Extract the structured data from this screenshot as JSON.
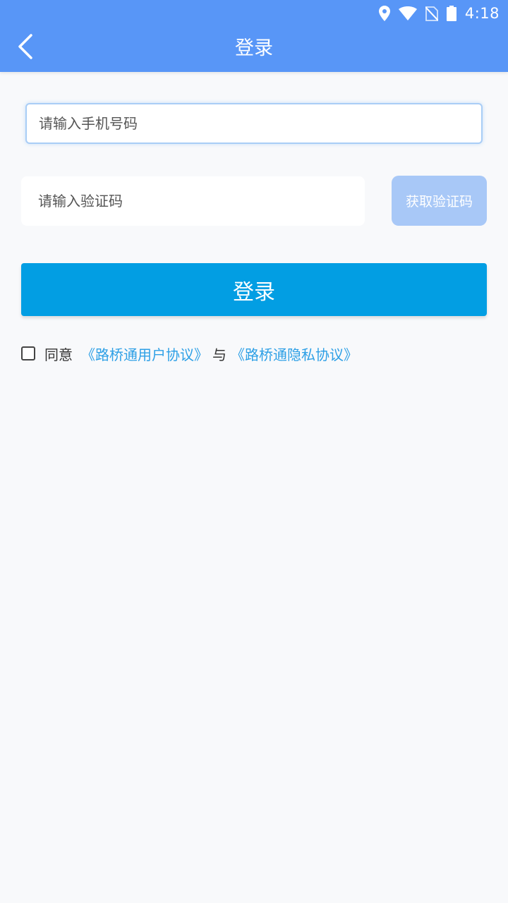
{
  "status_bar": {
    "time": "4:18",
    "icons": [
      "location-icon",
      "wifi-icon",
      "no-sim-icon",
      "battery-icon"
    ]
  },
  "header": {
    "title": "登录",
    "back_icon": "chevron-left-icon"
  },
  "form": {
    "phone_placeholder": "请输入手机号码",
    "code_placeholder": "请输入验证码",
    "get_code_label": "获取验证码",
    "login_label": "登录"
  },
  "agreement": {
    "agree_label": "同意",
    "user_agreement": "《路桥通用户协议》",
    "joiner": "与",
    "privacy_agreement": "《路桥通隐私协议》",
    "checked": false
  },
  "colors": {
    "header_bg": "#5896f7",
    "login_button": "#029ee3",
    "get_code_button": "#a8c8f7",
    "link": "#2ea0e6",
    "page_bg": "#f8f9fb"
  }
}
